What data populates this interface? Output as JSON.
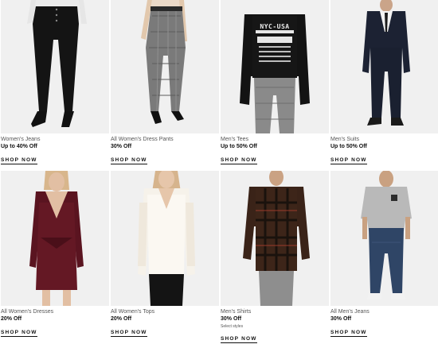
{
  "products": [
    {
      "category": "Women's Jeans",
      "offer": "Up to 40% Off",
      "cta": "SHOP NOW",
      "photo": "black-skinny-jeans-photo"
    },
    {
      "category": "All Women's Dress Pants",
      "offer": "30% Off",
      "cta": "SHOP NOW",
      "photo": "plaid-dress-pants-photo"
    },
    {
      "category": "Men's Tees",
      "offer": "Up to 50% Off",
      "cta": "SHOP NOW",
      "photo": "graphic-sweater-photo",
      "graphic_text": "NYC-USA"
    },
    {
      "category": "Men's Suits",
      "offer": "Up to 50% Off",
      "cta": "SHOP NOW",
      "photo": "navy-suit-photo"
    },
    {
      "category": "All Women's Dresses",
      "offer": "20% Off",
      "cta": "SHOP NOW",
      "photo": "burgundy-wrap-dress-photo"
    },
    {
      "category": "All Women's Tops",
      "offer": "20% Off",
      "cta": "SHOP NOW",
      "photo": "white-lace-top-photo"
    },
    {
      "category": "Men's Shirts",
      "offer": "30% Off",
      "note": "Select styles",
      "cta": "SHOP NOW",
      "photo": "plaid-flannel-shirt-photo"
    },
    {
      "category": "All Men's Jeans",
      "offer": "30% Off",
      "cta": "SHOP NOW",
      "photo": "mens-jeans-tee-photo"
    }
  ],
  "colors": {
    "background": "#ffffff",
    "image_bg": "#f0f0f0",
    "text": "#111111",
    "muted": "#555555"
  }
}
